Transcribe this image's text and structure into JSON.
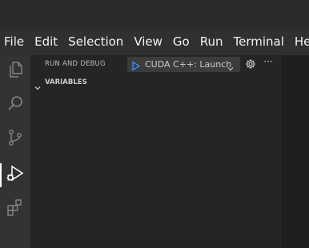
{
  "menubar": {
    "items": [
      "File",
      "Edit",
      "Selection",
      "View",
      "Go",
      "Run",
      "Terminal",
      "Help"
    ]
  },
  "activity_bar": {
    "items": [
      {
        "name": "explorer-icon",
        "active": false
      },
      {
        "name": "search-icon",
        "active": false
      },
      {
        "name": "source-control-icon",
        "active": false
      },
      {
        "name": "run-debug-icon",
        "active": true
      },
      {
        "name": "extensions-icon",
        "active": false
      }
    ]
  },
  "sidebar": {
    "title": "RUN AND DEBUG",
    "launch_config": "CUDA C++: Launch",
    "more_label": "···",
    "sections": {
      "variables": "VARIABLES"
    }
  },
  "colors": {
    "play_green": "#3794ff",
    "chevron": "#c5c5c5",
    "icon_inactive": "#858585",
    "icon_active": "#ffffff"
  }
}
